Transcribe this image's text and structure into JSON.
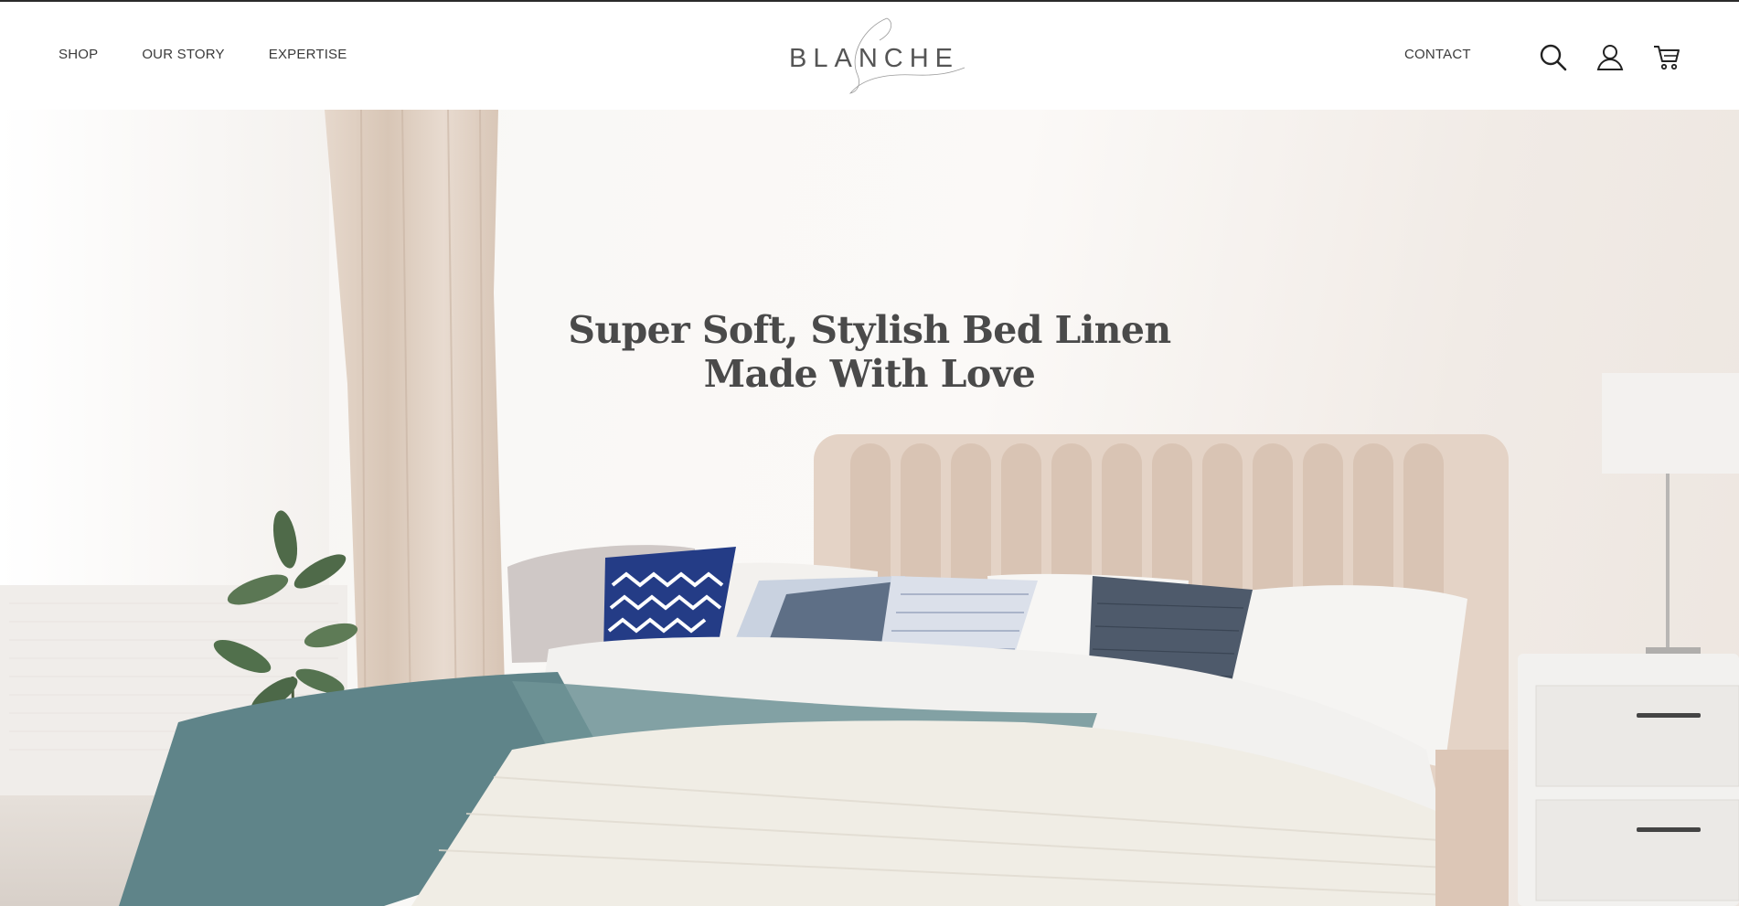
{
  "nav": {
    "left": [
      "SHOP",
      "OUR STORY",
      "EXPERTISE"
    ],
    "right": "CONTACT"
  },
  "logo": {
    "text": "BLANCHE"
  },
  "icons": [
    "search-icon",
    "account-icon",
    "cart-icon"
  ],
  "hero": {
    "line1": "Super Soft, Stylish Bed Linen",
    "line2": "Made With Love"
  },
  "colors": {
    "text": "#3a3a3a",
    "headline": "#4a4a4a",
    "headboard": "#e2cfc1",
    "throw_teal": "#5f8489",
    "pillow_navy": "#243c86"
  }
}
